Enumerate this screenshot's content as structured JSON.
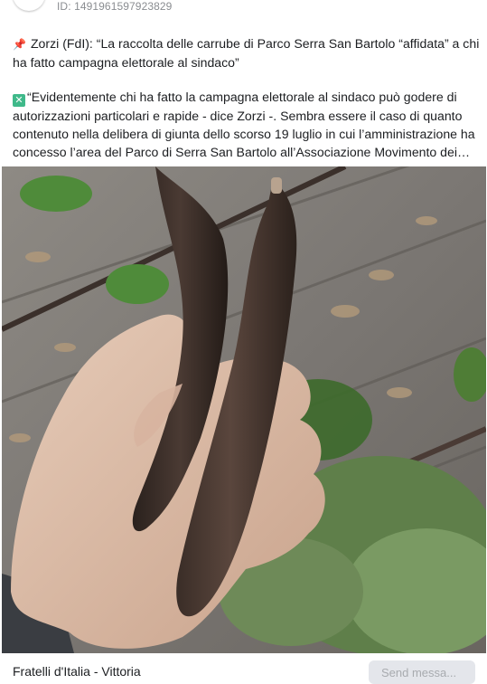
{
  "post": {
    "id_text": "ID: 1491961597923829",
    "headline_lines": [
      "Zorzi (FdI): “La raccolta delle carrube di Parco Serra San Bartolo “affidata” a chi",
      "ha fatto campagna elettorale al sindaco”"
    ],
    "body_lines": [
      "“Evidentemente chi ha fatto la campagna elettorale al sindaco può godere di",
      "autorizzazioni particolari e rapide - dice Zorzi -. Sembra essere il caso di quanto",
      "contenuto nella delibera di giunta dello scorso 19 luglio in cui l’amministrazione ha",
      "concesso l’area del Parco di Serra San Bartolo all’Associazione Movimento dei…"
    ],
    "pin_icon": "pushpin-icon",
    "x_icon": "cross-mark-button-icon",
    "x_icon_glyph": "✕"
  },
  "photo": {
    "description_icon": "carob-pods-photo"
  },
  "footer": {
    "page_name": "Fratelli d'Italia - Vittoria",
    "send_button_label": "Send messa..."
  },
  "colors": {
    "flag_green": "#009246",
    "flag_white": "#ffffff",
    "flag_red": "#ce2b37",
    "x_box": "#3fb98a",
    "pin": "#d93b3b"
  }
}
